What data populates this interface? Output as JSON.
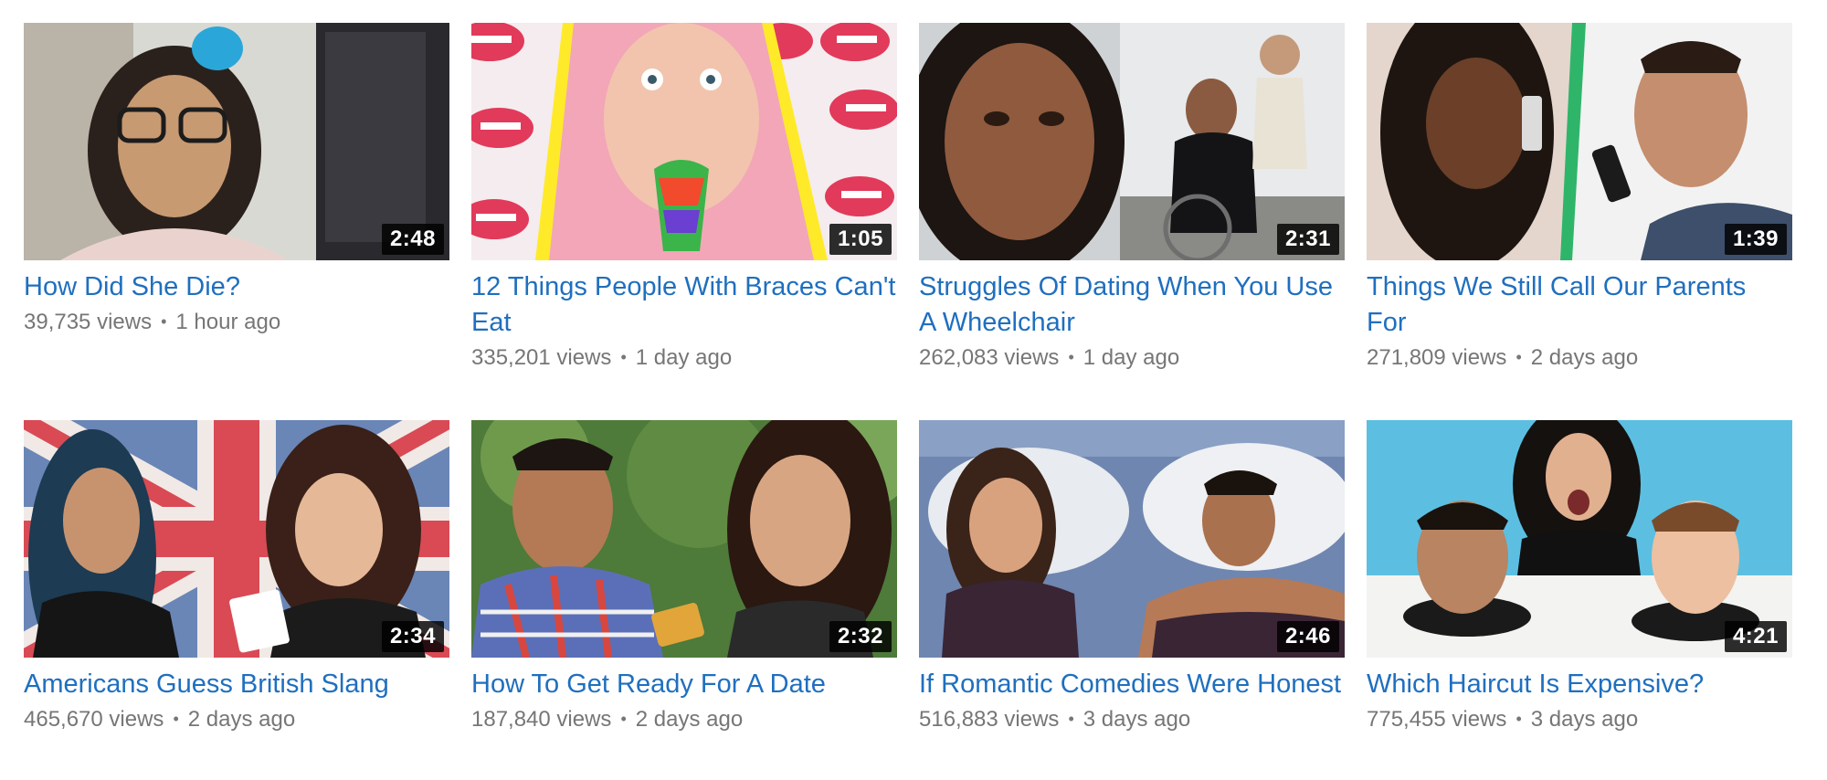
{
  "videos": [
    {
      "title": "How Did She Die?",
      "views": "39,735 views",
      "age": "1 hour ago",
      "duration": "2:48"
    },
    {
      "title": "12 Things People With Braces Can't Eat",
      "views": "335,201 views",
      "age": "1 day ago",
      "duration": "1:05"
    },
    {
      "title": "Struggles Of Dating When You Use A Wheelchair",
      "views": "262,083 views",
      "age": "1 day ago",
      "duration": "2:31"
    },
    {
      "title": "Things We Still Call Our Parents For",
      "views": "271,809 views",
      "age": "2 days ago",
      "duration": "1:39"
    },
    {
      "title": "Americans Guess British Slang",
      "views": "465,670 views",
      "age": "2 days ago",
      "duration": "2:34"
    },
    {
      "title": "How To Get Ready For A Date",
      "views": "187,840 views",
      "age": "2 days ago",
      "duration": "2:32"
    },
    {
      "title": "If Romantic Comedies Were Honest",
      "views": "516,883 views",
      "age": "3 days ago",
      "duration": "2:46"
    },
    {
      "title": "Which Haircut Is Expensive?",
      "views": "775,455 views",
      "age": "3 days ago",
      "duration": "4:21"
    }
  ],
  "separator": "•",
  "colors": {
    "title_link": "#1f6fbf",
    "meta_text": "#767676",
    "duration_bg": "#000000"
  }
}
